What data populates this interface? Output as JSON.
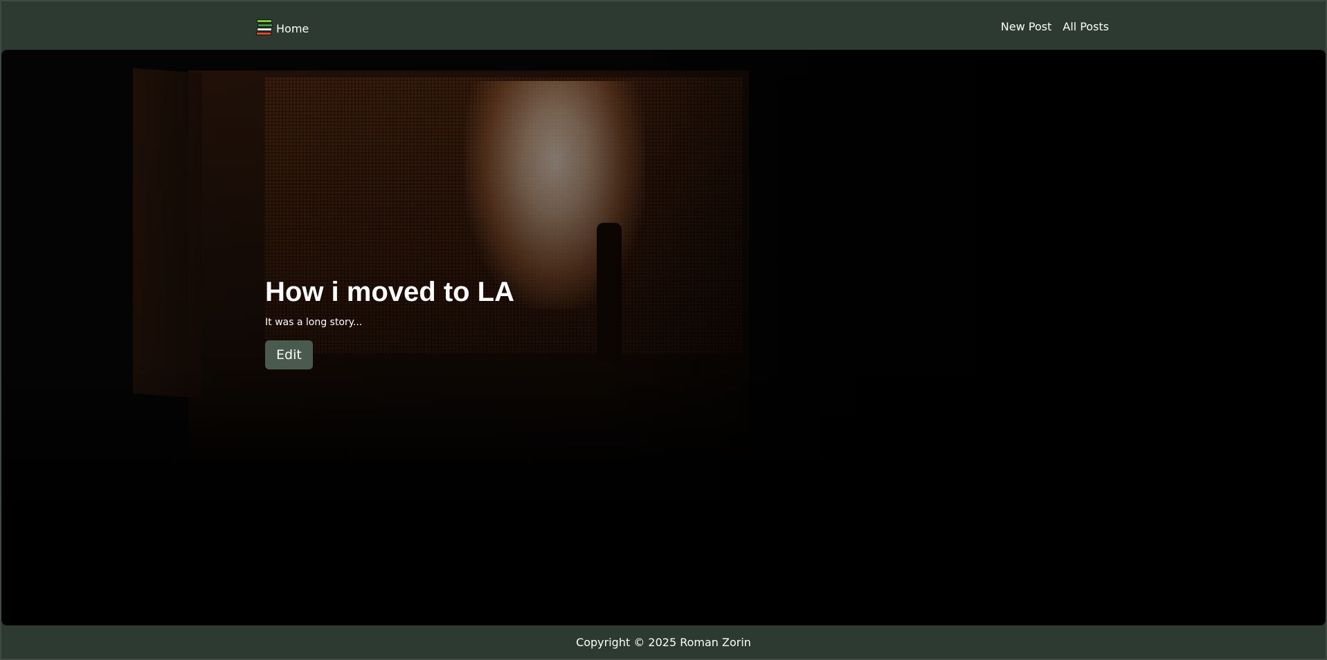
{
  "nav": {
    "brand_label": "Home",
    "brand_icon": "books-stack-icon",
    "links": [
      {
        "label": "New Post"
      },
      {
        "label": "All Posts"
      }
    ]
  },
  "hero": {
    "title": "How i moved to LA",
    "subtitle": "It was a long story...",
    "edit_label": "Edit"
  },
  "footer": {
    "copyright": "Copyright © 2025 Roman Zorin"
  },
  "colors": {
    "navbar_bg": "#2d3a32",
    "button_bg": "#4a5a4f",
    "text": "#ffffff"
  }
}
